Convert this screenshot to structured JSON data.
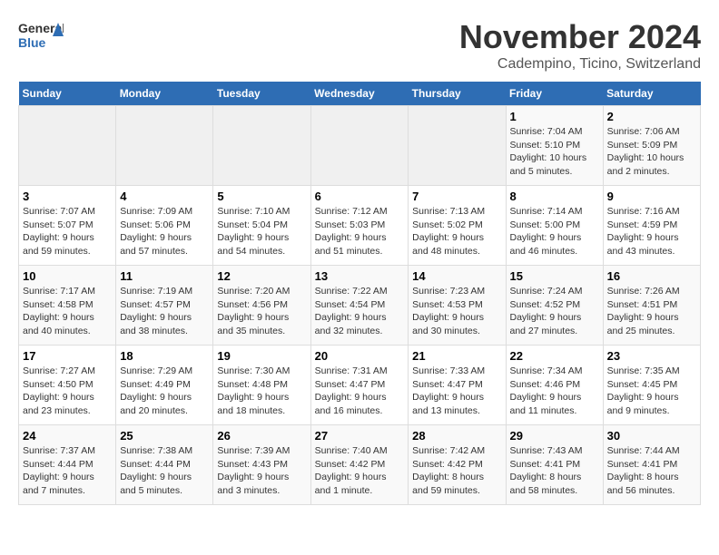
{
  "header": {
    "logo_general": "General",
    "logo_blue": "Blue",
    "month": "November 2024",
    "location": "Cadempino, Ticino, Switzerland"
  },
  "weekdays": [
    "Sunday",
    "Monday",
    "Tuesday",
    "Wednesday",
    "Thursday",
    "Friday",
    "Saturday"
  ],
  "weeks": [
    [
      {
        "day": "",
        "info": ""
      },
      {
        "day": "",
        "info": ""
      },
      {
        "day": "",
        "info": ""
      },
      {
        "day": "",
        "info": ""
      },
      {
        "day": "",
        "info": ""
      },
      {
        "day": "1",
        "info": "Sunrise: 7:04 AM\nSunset: 5:10 PM\nDaylight: 10 hours\nand 5 minutes."
      },
      {
        "day": "2",
        "info": "Sunrise: 7:06 AM\nSunset: 5:09 PM\nDaylight: 10 hours\nand 2 minutes."
      }
    ],
    [
      {
        "day": "3",
        "info": "Sunrise: 7:07 AM\nSunset: 5:07 PM\nDaylight: 9 hours\nand 59 minutes."
      },
      {
        "day": "4",
        "info": "Sunrise: 7:09 AM\nSunset: 5:06 PM\nDaylight: 9 hours\nand 57 minutes."
      },
      {
        "day": "5",
        "info": "Sunrise: 7:10 AM\nSunset: 5:04 PM\nDaylight: 9 hours\nand 54 minutes."
      },
      {
        "day": "6",
        "info": "Sunrise: 7:12 AM\nSunset: 5:03 PM\nDaylight: 9 hours\nand 51 minutes."
      },
      {
        "day": "7",
        "info": "Sunrise: 7:13 AM\nSunset: 5:02 PM\nDaylight: 9 hours\nand 48 minutes."
      },
      {
        "day": "8",
        "info": "Sunrise: 7:14 AM\nSunset: 5:00 PM\nDaylight: 9 hours\nand 46 minutes."
      },
      {
        "day": "9",
        "info": "Sunrise: 7:16 AM\nSunset: 4:59 PM\nDaylight: 9 hours\nand 43 minutes."
      }
    ],
    [
      {
        "day": "10",
        "info": "Sunrise: 7:17 AM\nSunset: 4:58 PM\nDaylight: 9 hours\nand 40 minutes."
      },
      {
        "day": "11",
        "info": "Sunrise: 7:19 AM\nSunset: 4:57 PM\nDaylight: 9 hours\nand 38 minutes."
      },
      {
        "day": "12",
        "info": "Sunrise: 7:20 AM\nSunset: 4:56 PM\nDaylight: 9 hours\nand 35 minutes."
      },
      {
        "day": "13",
        "info": "Sunrise: 7:22 AM\nSunset: 4:54 PM\nDaylight: 9 hours\nand 32 minutes."
      },
      {
        "day": "14",
        "info": "Sunrise: 7:23 AM\nSunset: 4:53 PM\nDaylight: 9 hours\nand 30 minutes."
      },
      {
        "day": "15",
        "info": "Sunrise: 7:24 AM\nSunset: 4:52 PM\nDaylight: 9 hours\nand 27 minutes."
      },
      {
        "day": "16",
        "info": "Sunrise: 7:26 AM\nSunset: 4:51 PM\nDaylight: 9 hours\nand 25 minutes."
      }
    ],
    [
      {
        "day": "17",
        "info": "Sunrise: 7:27 AM\nSunset: 4:50 PM\nDaylight: 9 hours\nand 23 minutes."
      },
      {
        "day": "18",
        "info": "Sunrise: 7:29 AM\nSunset: 4:49 PM\nDaylight: 9 hours\nand 20 minutes."
      },
      {
        "day": "19",
        "info": "Sunrise: 7:30 AM\nSunset: 4:48 PM\nDaylight: 9 hours\nand 18 minutes."
      },
      {
        "day": "20",
        "info": "Sunrise: 7:31 AM\nSunset: 4:47 PM\nDaylight: 9 hours\nand 16 minutes."
      },
      {
        "day": "21",
        "info": "Sunrise: 7:33 AM\nSunset: 4:47 PM\nDaylight: 9 hours\nand 13 minutes."
      },
      {
        "day": "22",
        "info": "Sunrise: 7:34 AM\nSunset: 4:46 PM\nDaylight: 9 hours\nand 11 minutes."
      },
      {
        "day": "23",
        "info": "Sunrise: 7:35 AM\nSunset: 4:45 PM\nDaylight: 9 hours\nand 9 minutes."
      }
    ],
    [
      {
        "day": "24",
        "info": "Sunrise: 7:37 AM\nSunset: 4:44 PM\nDaylight: 9 hours\nand 7 minutes."
      },
      {
        "day": "25",
        "info": "Sunrise: 7:38 AM\nSunset: 4:44 PM\nDaylight: 9 hours\nand 5 minutes."
      },
      {
        "day": "26",
        "info": "Sunrise: 7:39 AM\nSunset: 4:43 PM\nDaylight: 9 hours\nand 3 minutes."
      },
      {
        "day": "27",
        "info": "Sunrise: 7:40 AM\nSunset: 4:42 PM\nDaylight: 9 hours\nand 1 minute."
      },
      {
        "day": "28",
        "info": "Sunrise: 7:42 AM\nSunset: 4:42 PM\nDaylight: 8 hours\nand 59 minutes."
      },
      {
        "day": "29",
        "info": "Sunrise: 7:43 AM\nSunset: 4:41 PM\nDaylight: 8 hours\nand 58 minutes."
      },
      {
        "day": "30",
        "info": "Sunrise: 7:44 AM\nSunset: 4:41 PM\nDaylight: 8 hours\nand 56 minutes."
      }
    ]
  ]
}
